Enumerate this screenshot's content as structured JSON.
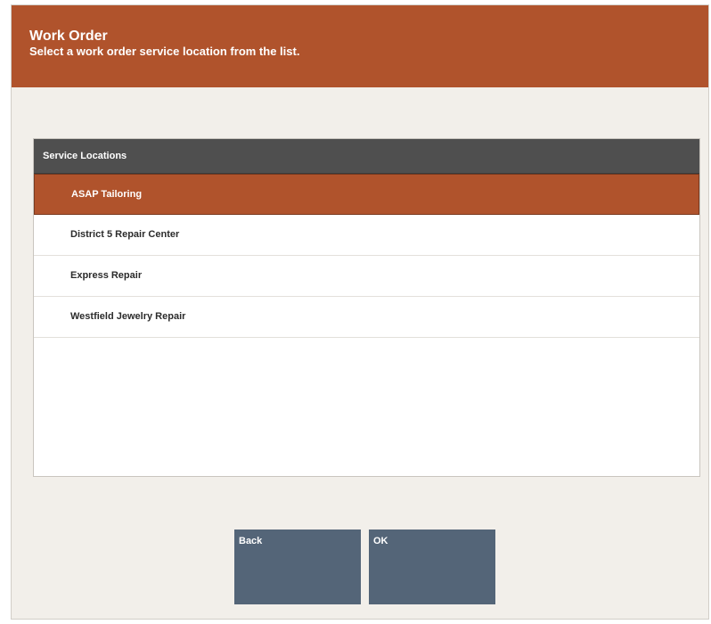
{
  "header": {
    "title": "Work Order",
    "subtitle": "Select a work order service location from the list."
  },
  "list": {
    "header": "Service Locations",
    "selected_index": 0,
    "items": [
      {
        "label": "ASAP Tailoring"
      },
      {
        "label": "District 5 Repair Center"
      },
      {
        "label": "Express Repair"
      },
      {
        "label": "Westfield Jewelry Repair"
      }
    ]
  },
  "buttons": {
    "back_label": "Back",
    "ok_label": "OK"
  },
  "colors": {
    "accent": "#b0532c",
    "list_header_bg": "#4f4f4f",
    "button_bg": "#546578",
    "page_bg": "#f2efea"
  }
}
